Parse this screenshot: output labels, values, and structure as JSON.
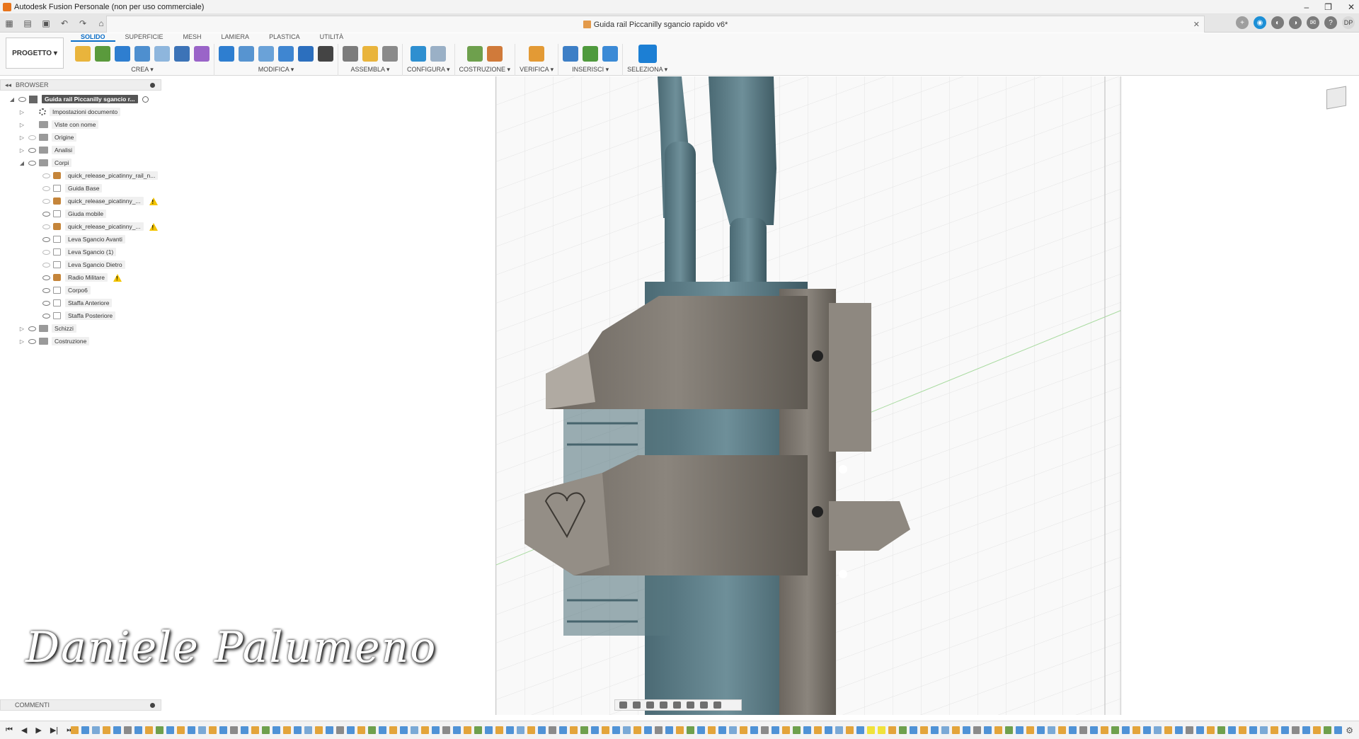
{
  "window": {
    "title": "Autodesk Fusion Personale (non per uso commerciale)",
    "controls": [
      "–",
      "❐",
      "✕"
    ]
  },
  "document_tab": {
    "title": "Guida rail Piccanilly sgancio rapido v6*",
    "close": "✕"
  },
  "account": {
    "initials": "DP"
  },
  "ribbon": {
    "workspace": "PROGETTO ▾",
    "tabs": [
      "SOLIDO",
      "SUPERFICIE",
      "MESH",
      "LAMIERA",
      "PLASTICA",
      "UTILITÀ"
    ],
    "active_tab": "SOLIDO",
    "groups": [
      {
        "label": "CREA ▾",
        "icons": [
          "new-component-icon",
          "create-sketch-icon",
          "extrude-icon",
          "revolve-icon",
          "hole-icon",
          "pattern-icon",
          "form-icon"
        ]
      },
      {
        "label": "MODIFICA ▾",
        "icons": [
          "press-pull-icon",
          "fillet-icon",
          "chamfer-icon",
          "shell-icon",
          "combine-icon",
          "move-icon"
        ]
      },
      {
        "label": "ASSEMBLA ▾",
        "icons": [
          "joint-icon",
          "new-component-icon",
          "rigid-group-icon"
        ]
      },
      {
        "label": "CONFIGURA ▾",
        "icons": [
          "configure-icon",
          "table-icon"
        ]
      },
      {
        "label": "COSTRUZIONE ▾",
        "icons": [
          "offset-plane-icon",
          "plane-at-angle-icon"
        ]
      },
      {
        "label": "VERIFICA ▾",
        "icons": [
          "measure-icon"
        ]
      },
      {
        "label": "INSERISCI ▾",
        "icons": [
          "insert-link-icon",
          "insert-derive-icon",
          "insert-image-icon"
        ]
      },
      {
        "label": "SELEZIONA ▾",
        "icons": [
          "select-icon"
        ]
      }
    ]
  },
  "browser": {
    "title": "BROWSER",
    "root": "Guida rail Piccanilly sgancio r...",
    "items": [
      {
        "label": "Impostazioni documento",
        "type": "gear",
        "level": 1,
        "arrow": "▷"
      },
      {
        "label": "Viste con nome",
        "type": "folder",
        "level": 1,
        "arrow": "▷"
      },
      {
        "label": "Origine",
        "type": "folder",
        "level": 1,
        "arrow": "▷",
        "eye": true
      },
      {
        "label": "Analisi",
        "type": "folder",
        "level": 1,
        "arrow": "▷",
        "eye": true
      },
      {
        "label": "Corpi",
        "type": "folder",
        "level": 1,
        "arrow": "◢",
        "eye": true
      },
      {
        "label": "quick_release_picatinny_rail_n...",
        "type": "mesh",
        "level": 2,
        "eye": true
      },
      {
        "label": "Guida Base",
        "type": "body",
        "level": 2,
        "eye": true
      },
      {
        "label": "quick_release_picatinny_...",
        "type": "mesh",
        "level": 2,
        "eye": true,
        "warn": true
      },
      {
        "label": "Giuda mobile",
        "type": "body",
        "level": 2,
        "eye": true
      },
      {
        "label": "quick_release_picatinny_...",
        "type": "mesh",
        "level": 2,
        "eye": true,
        "warn": true
      },
      {
        "label": "Leva Sgancio Avanti",
        "type": "body",
        "level": 2,
        "eye": true
      },
      {
        "label": "Leva Sgancio (1)",
        "type": "body",
        "level": 2,
        "eye": true
      },
      {
        "label": "Leva Sgancio Dietro",
        "type": "body",
        "level": 2,
        "eye": true
      },
      {
        "label": "Radio Militare",
        "type": "mesh",
        "level": 2,
        "eye": true,
        "warn": true
      },
      {
        "label": "Corpo6",
        "type": "body",
        "level": 2,
        "eye": true
      },
      {
        "label": "Staffa Anteriore",
        "type": "body",
        "level": 2,
        "eye": true
      },
      {
        "label": "Staffa Posteriore",
        "type": "body",
        "level": 2,
        "eye": true
      },
      {
        "label": "Schizzi",
        "type": "folder",
        "level": 1,
        "arrow": "▷",
        "eye": true
      },
      {
        "label": "Costruzione",
        "type": "folder",
        "level": 1,
        "arrow": "▷",
        "eye": true
      }
    ]
  },
  "comments": {
    "title": "COMMENTI"
  },
  "signature": "Daniele Palumeno",
  "timeline": {
    "controls": [
      "⏮",
      "◀",
      "▶",
      "▶|",
      "⏭"
    ]
  },
  "colors": {
    "accent": "#0a6ec8",
    "mesh_teal": "#5f7f88",
    "body_gray": "#7d776f",
    "warning": "#f3c400"
  }
}
